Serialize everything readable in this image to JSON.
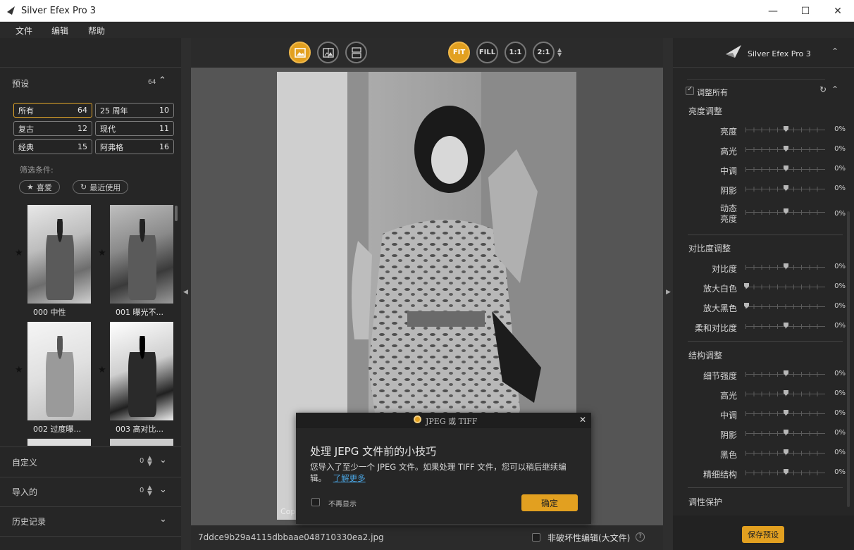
{
  "window": {
    "title": "Silver Efex Pro 3",
    "minimize": "—",
    "maximize": "☐",
    "close": "✕"
  },
  "menu": [
    "文件",
    "编辑",
    "帮助"
  ],
  "presets": {
    "title": "预设",
    "count": "64",
    "buttons": [
      {
        "label": "所有",
        "count": "64",
        "active": true
      },
      {
        "label": "25 周年",
        "count": "10"
      },
      {
        "label": "复古",
        "count": "12"
      },
      {
        "label": "现代",
        "count": "11"
      },
      {
        "label": "经典",
        "count": "15"
      },
      {
        "label": "阿弗格",
        "count": "16"
      }
    ],
    "filter_label": "筛选条件:",
    "filters": [
      {
        "label": "喜爱",
        "icon": "star-icon"
      },
      {
        "label": "最近使用",
        "icon": "clock-icon"
      }
    ],
    "thumbs": [
      {
        "label": "000 中性"
      },
      {
        "label": "001 曝光不..."
      },
      {
        "label": "002 过度曝..."
      },
      {
        "label": "003 高对比..."
      }
    ]
  },
  "sections": [
    {
      "label": "自定义",
      "count": "0"
    },
    {
      "label": "导入的",
      "count": "0"
    },
    {
      "label": "历史记录",
      "count": ""
    }
  ],
  "toolbar": {
    "views": [
      "single-view-icon",
      "split-view-icon",
      "compare-view-icon"
    ],
    "zoom": [
      {
        "label": "FIT",
        "active": true
      },
      {
        "label": "FILL"
      },
      {
        "label": "1:1"
      },
      {
        "label": "2:1"
      }
    ]
  },
  "status": {
    "filename": "7ddce9b29a4115dbbaae048710330ea2.jpg",
    "nondestructive": "非破坏性编辑(大文件)",
    "help": "?"
  },
  "right": {
    "brand": "Silver Efex Pro 3",
    "adjust_all": "调整所有",
    "groups": [
      {
        "title": "亮度调整",
        "sliders": [
          {
            "label": "亮度",
            "value": "0%"
          },
          {
            "label": "高光",
            "value": "0%"
          },
          {
            "label": "中调",
            "value": "0%"
          },
          {
            "label": "阴影",
            "value": "0%"
          },
          {
            "label": "动态\n亮度",
            "value": "0%"
          }
        ]
      },
      {
        "title": "对比度调整",
        "sliders": [
          {
            "label": "对比度",
            "value": "0%"
          },
          {
            "label": "放大白色",
            "value": "0%"
          },
          {
            "label": "放大黑色",
            "value": "0%"
          },
          {
            "label": "柔和对比度",
            "value": "0%"
          }
        ]
      },
      {
        "title": "结构调整",
        "sliders": [
          {
            "label": "细节强度",
            "value": "0%"
          },
          {
            "label": "高光",
            "value": "0%"
          },
          {
            "label": "中调",
            "value": "0%"
          },
          {
            "label": "阴影",
            "value": "0%"
          },
          {
            "label": "黑色",
            "value": "0%"
          },
          {
            "label": "精细结构",
            "value": "0%"
          }
        ]
      }
    ],
    "tone_protect": "调性保护",
    "save_preset": "保存预设"
  },
  "dialog": {
    "header": "JPEG 或 TIFF",
    "title": "处理 JEPG 文件前的小技巧",
    "body": "您导入了至少一个 JPEG 文件。如果处理 TIFF 文件，您可以稍后继续编辑。",
    "link": "了解更多",
    "dont_show": "不再显示",
    "ok": "确定"
  },
  "photo": {
    "corner_text": "Cop"
  },
  "colors": {
    "accent": "#e2a020",
    "panel": "#262626",
    "canvas": "#555555"
  }
}
